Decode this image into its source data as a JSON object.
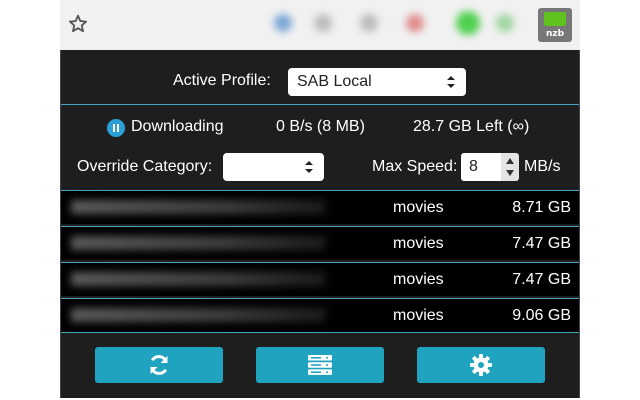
{
  "browser": {
    "star_icon": "star-icon",
    "extension_badge": "nzb",
    "colors": {
      "extension_green": "#5fc21e"
    }
  },
  "profile": {
    "label": "Active Profile:",
    "selected": "SAB Local"
  },
  "status": {
    "state_icon": "pause-circle-icon",
    "state": "Downloading",
    "speed": "0 B/s (8 MB)",
    "remaining": "28.7 GB Left (∞)"
  },
  "controls": {
    "override_category_label": "Override Category:",
    "override_category_value": "",
    "max_speed_label": "Max Speed:",
    "max_speed_value": "8",
    "max_speed_unit": "MB/s"
  },
  "queue": [
    {
      "name": "",
      "category": "movies",
      "size": "8.71 GB"
    },
    {
      "name": "",
      "category": "movies",
      "size": "7.47 GB"
    },
    {
      "name": "",
      "category": "movies",
      "size": "7.47 GB"
    },
    {
      "name": "",
      "category": "movies",
      "size": "9.06 GB"
    }
  ],
  "buttons": [
    {
      "icon": "refresh-icon"
    },
    {
      "icon": "server-icon"
    },
    {
      "icon": "gear-icon"
    }
  ],
  "colors": {
    "accent": "#1fa3bf",
    "status_icon": "#2aa0d6",
    "background": "#1e1e1e",
    "row_background": "#000000"
  }
}
